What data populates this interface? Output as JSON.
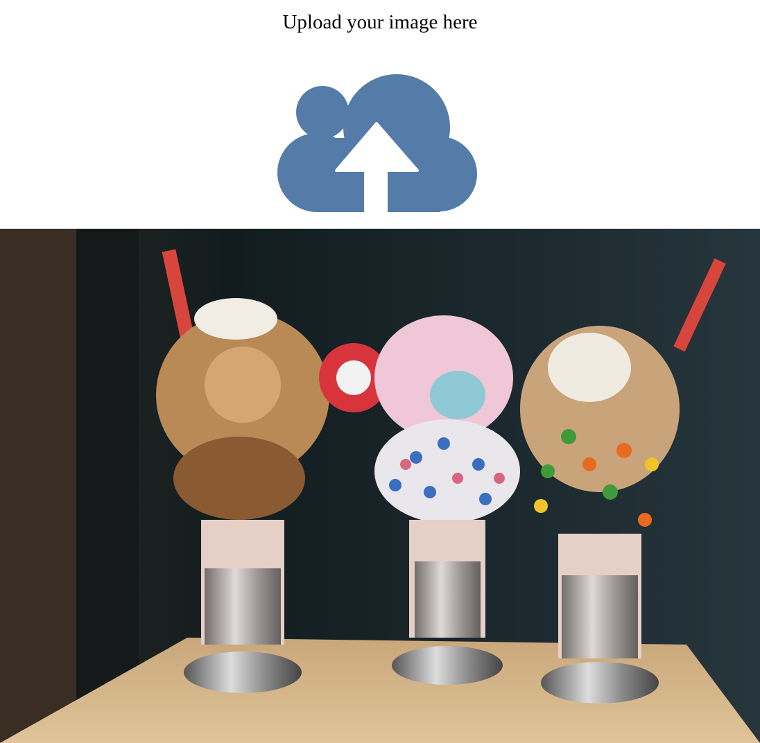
{
  "page": {
    "title": "Upload your image here"
  },
  "upload_icon": {
    "name": "cloud-upload-icon",
    "color": "#557ba8"
  },
  "photo": {
    "subject": "milkshakes"
  }
}
